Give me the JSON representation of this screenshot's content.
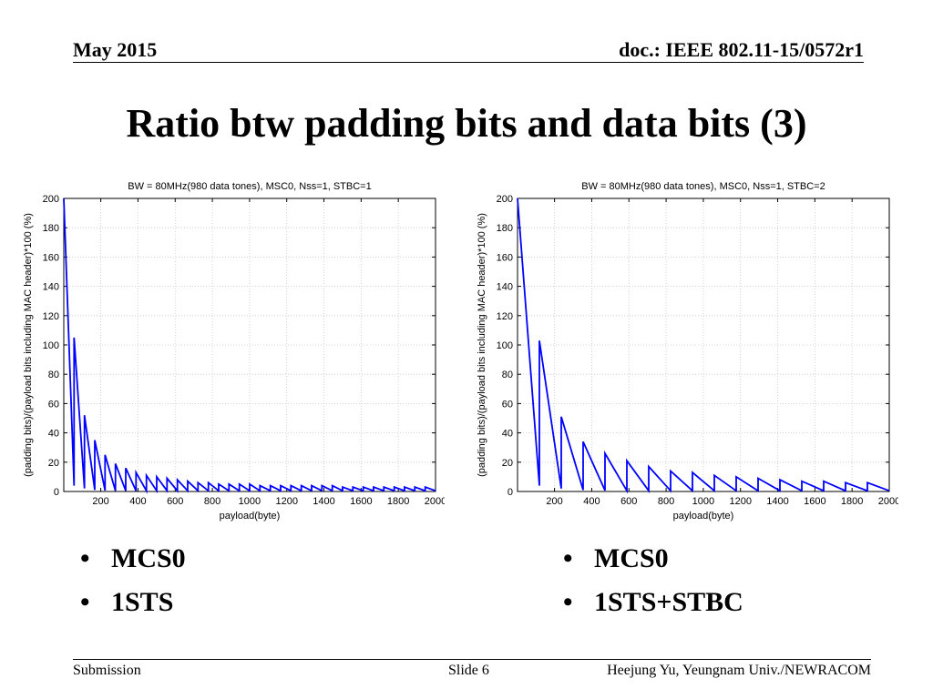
{
  "header": {
    "date": "May 2015",
    "doc": "doc.: IEEE 802.11-15/0572r1"
  },
  "title": "Ratio btw padding bits and data bits (3)",
  "bullets_left": [
    "MCS0",
    "1STS"
  ],
  "bullets_right": [
    "MCS0",
    "1STS+STBC"
  ],
  "footer": {
    "left": "Submission",
    "center": "Slide 6",
    "right": "Heejung Yu, Yeungnam Univ./NEWRACOM"
  },
  "chart_data": [
    {
      "type": "line",
      "title": "BW = 80MHz(980 data tones), MSC0, Nss=1, STBC=1",
      "xlabel": "payload(byte)",
      "ylabel": "(padding bits)/(payload bits including MAC header)*100 (%)",
      "xlim": [
        1,
        2000
      ],
      "ylim": [
        0,
        200
      ],
      "xticks": [
        200,
        400,
        600,
        800,
        1000,
        1200,
        1400,
        1600,
        1800,
        2000
      ],
      "yticks": [
        0,
        20,
        40,
        60,
        80,
        100,
        120,
        140,
        160,
        180,
        200
      ],
      "grid": true,
      "series": [
        {
          "color": "#0000ff",
          "peaks": [
            200,
            105,
            52,
            35,
            25,
            19,
            16,
            13,
            11,
            10,
            9,
            8,
            7,
            6,
            6,
            5,
            5,
            5,
            5,
            4,
            4,
            4,
            4,
            4,
            4,
            4,
            4,
            3,
            3,
            3,
            3,
            3,
            3,
            3,
            3,
            3
          ]
        }
      ]
    },
    {
      "type": "line",
      "title": "BW = 80MHz(980 data tones), MSC0, Nss=1, STBC=2",
      "xlabel": "payload(byte)",
      "ylabel": "(padding bits)/(payload bits including MAC header)*100 (%)",
      "xlim": [
        1,
        2000
      ],
      "ylim": [
        0,
        200
      ],
      "xticks": [
        200,
        400,
        600,
        800,
        1000,
        1200,
        1400,
        1600,
        1800,
        2000
      ],
      "yticks": [
        0,
        20,
        40,
        60,
        80,
        100,
        120,
        140,
        160,
        180,
        200
      ],
      "grid": true,
      "series": [
        {
          "color": "#0000ff",
          "peaks": [
            200,
            103,
            51,
            34,
            26,
            21,
            17,
            14,
            13,
            11,
            10,
            9,
            8,
            7,
            7,
            6,
            6
          ]
        }
      ]
    }
  ]
}
